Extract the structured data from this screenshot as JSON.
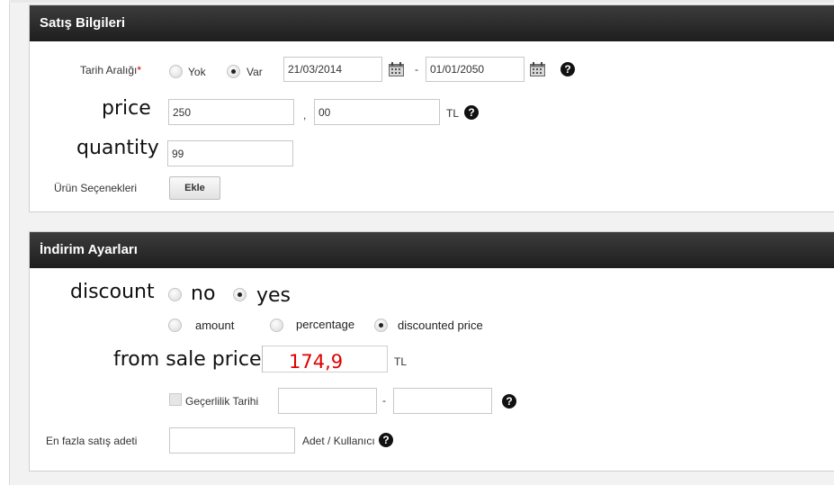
{
  "sale_section": {
    "title": "Satış Bilgileri",
    "date_range": {
      "label": "Tarih Aralığı",
      "required_mark": "*",
      "options": [
        "Yok",
        "Var"
      ],
      "selected": "Var",
      "start_date": "21/03/2014",
      "separator": "-",
      "end_date": "01/01/2050",
      "help_icon": "?"
    },
    "price": {
      "label": "price",
      "integer_value": "250",
      "decimal_separator": ",",
      "decimal_value": "00",
      "currency": "TL",
      "help_icon": "?"
    },
    "quantity": {
      "label": "quantity",
      "value": "99"
    },
    "options": {
      "label": "Ürün Seçenekleri",
      "add_button": "Ekle"
    }
  },
  "discount_section": {
    "title": "İndirim Ayarları",
    "discount": {
      "label": "discount",
      "options": [
        "no",
        "yes"
      ],
      "selected": "yes"
    },
    "type_options": {
      "items": [
        "amount",
        "percentage",
        "discounted price"
      ],
      "selected": "discounted price"
    },
    "from_sale_price": {
      "label": "from sale price",
      "value": "174,9",
      "currency": "TL"
    },
    "validity": {
      "label": "Geçerlilik Tarihi",
      "start_value": "",
      "separator": "-",
      "end_value": "",
      "help_icon": "?"
    },
    "max_sales": {
      "label": "En fazla satış adeti",
      "value": "",
      "unit": "Adet / Kullanıcı",
      "help_icon": "?"
    }
  },
  "colors": {
    "header_bg": "#2b2b2b",
    "accent_red": "#e00000",
    "required_red": "#cc0000"
  },
  "icons": {
    "calendar": "calendar-icon",
    "help": "help-icon"
  }
}
